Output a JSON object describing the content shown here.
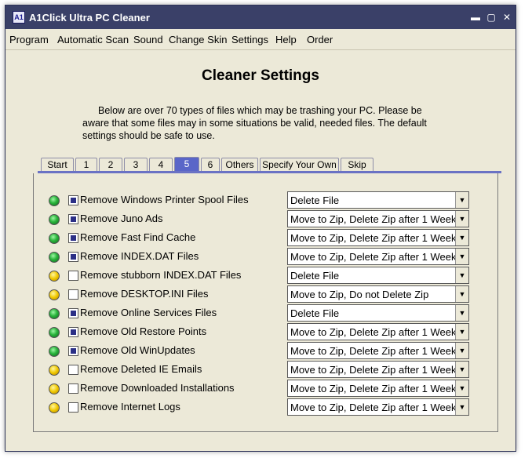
{
  "window": {
    "title": "A1Click Ultra PC Cleaner",
    "icon_text": "A1"
  },
  "window_controls": {
    "minimize": "▬",
    "maximize": "▢",
    "close": "✕"
  },
  "menu": [
    "Program",
    "Automatic Scan",
    "Sound",
    "Change Skin",
    "Settings",
    "Help",
    "Order"
  ],
  "heading": "Cleaner Settings",
  "intro": [
    "Below are over 70 types of files which may be trashing your PC.  Please be",
    "aware that some files may in some situations be valid, needed files.  The default",
    "settings should be safe to use."
  ],
  "tabs": [
    "Start",
    "1",
    "2",
    "3",
    "4",
    "5",
    "6",
    "Others",
    "Specify Your Own",
    "Skip"
  ],
  "active_tab": "5",
  "dropdown_arrow": "▼",
  "colors": {
    "titlebar": "#3a4068",
    "active_tab": "#5a66c8",
    "checkbox_fill": "#2b2f86",
    "led_green": "#2ab43c",
    "led_yellow": "#f0c800"
  },
  "rows": [
    {
      "label": "Remove Windows Printer Spool Files",
      "checked": true,
      "status": "green",
      "action": "Delete File"
    },
    {
      "label": "Remove Juno Ads",
      "checked": true,
      "status": "green",
      "action": "Move to Zip, Delete Zip after 1 Week"
    },
    {
      "label": "Remove Fast Find Cache",
      "checked": true,
      "status": "green",
      "action": "Move to Zip, Delete Zip after 1 Week"
    },
    {
      "label": "Remove INDEX.DAT Files",
      "checked": true,
      "status": "green",
      "action": "Move to Zip, Delete Zip after 1 Week"
    },
    {
      "label": "Remove stubborn INDEX.DAT Files",
      "checked": false,
      "status": "yellow",
      "action": "Delete File"
    },
    {
      "label": "Remove DESKTOP.INI Files",
      "checked": false,
      "status": "yellow",
      "action": "Move to Zip, Do not Delete Zip"
    },
    {
      "label": "Remove Online Services Files",
      "checked": true,
      "status": "green",
      "action": "Delete File"
    },
    {
      "label": "Remove Old Restore Points",
      "checked": true,
      "status": "green",
      "action": "Move to Zip, Delete Zip after 1 Week"
    },
    {
      "label": "Remove Old WinUpdates",
      "checked": true,
      "status": "green",
      "action": "Move to Zip, Delete Zip after 1 Week"
    },
    {
      "label": "Remove Deleted IE Emails",
      "checked": false,
      "status": "yellow",
      "action": "Move to Zip, Delete Zip after 1 Week"
    },
    {
      "label": "Remove Downloaded Installations",
      "checked": false,
      "status": "yellow",
      "action": "Move to Zip, Delete Zip after 1 Week"
    },
    {
      "label": "Remove Internet Logs",
      "checked": false,
      "status": "yellow",
      "action": "Move to Zip, Delete Zip after 1 Week"
    }
  ]
}
